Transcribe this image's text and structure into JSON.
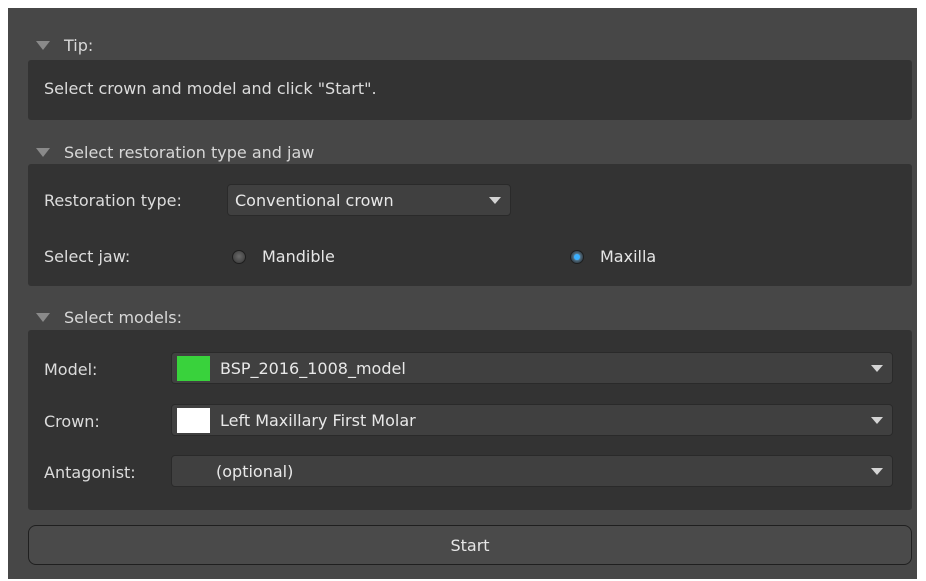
{
  "tip": {
    "header": "Tip:",
    "message": "Select crown and model and click \"Start\"."
  },
  "restoration": {
    "header": "Select restoration type and jaw",
    "type_label": "Restoration type:",
    "type_value": "Conventional crown",
    "jaw_label": "Select jaw:",
    "jaw_options": [
      "Mandible",
      "Maxilla"
    ],
    "jaw_selected": "Maxilla"
  },
  "models": {
    "header": "Select models:",
    "model_label": "Model:",
    "model_value": "BSP_2016_1008_model",
    "model_color": "#39d23c",
    "crown_label": "Crown:",
    "crown_value": "Left Maxillary First Molar",
    "crown_color": "#ffffff",
    "antagonist_label": "Antagonist:",
    "antagonist_value": "(optional)"
  },
  "actions": {
    "start_label": "Start"
  },
  "colors": {
    "background": "#474747",
    "panel": "#333333",
    "radio_checked": "#3ab0ff"
  }
}
